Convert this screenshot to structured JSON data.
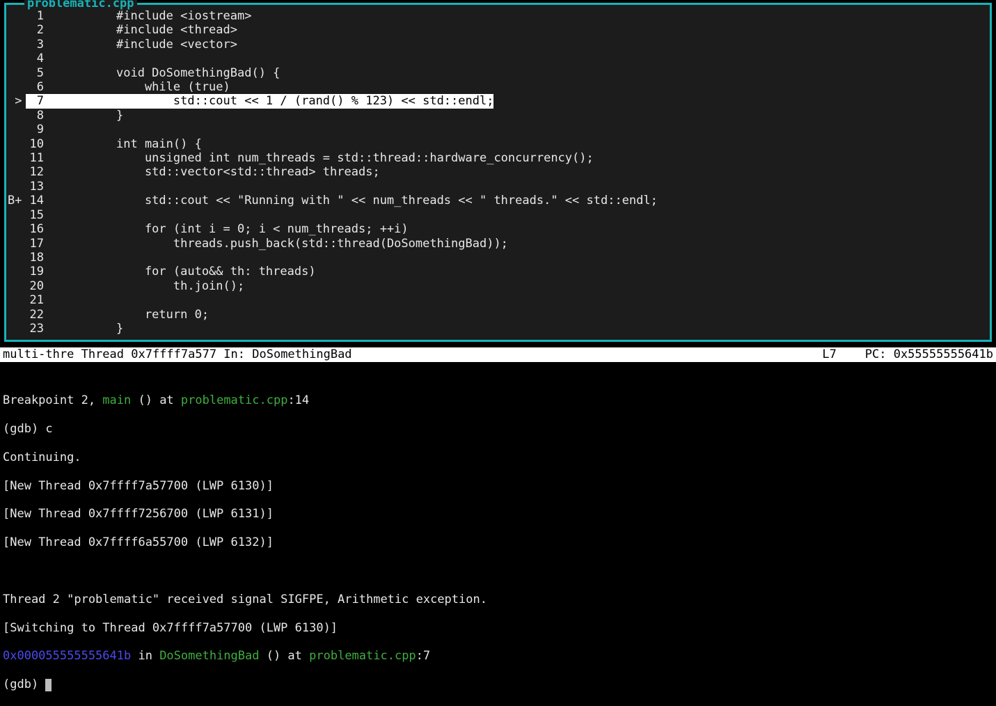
{
  "filename": "problematic.cpp",
  "source": {
    "lines": [
      {
        "n": 1,
        "marker": "",
        "text": "#include <iostream>"
      },
      {
        "n": 2,
        "marker": "",
        "text": "#include <thread>"
      },
      {
        "n": 3,
        "marker": "",
        "text": "#include <vector>"
      },
      {
        "n": 4,
        "marker": "",
        "text": ""
      },
      {
        "n": 5,
        "marker": "",
        "text": "void DoSomethingBad() {"
      },
      {
        "n": 6,
        "marker": "",
        "text": "    while (true)"
      },
      {
        "n": 7,
        "marker": " >",
        "text": "        std::cout << 1 / (rand() % 123) << std::endl;",
        "current": true
      },
      {
        "n": 8,
        "marker": "",
        "text": "}"
      },
      {
        "n": 9,
        "marker": "",
        "text": ""
      },
      {
        "n": 10,
        "marker": "",
        "text": "int main() {"
      },
      {
        "n": 11,
        "marker": "",
        "text": "    unsigned int num_threads = std::thread::hardware_concurrency();"
      },
      {
        "n": 12,
        "marker": "",
        "text": "    std::vector<std::thread> threads;"
      },
      {
        "n": 13,
        "marker": "",
        "text": ""
      },
      {
        "n": 14,
        "marker": "B+",
        "text": "    std::cout << \"Running with \" << num_threads << \" threads.\" << std::endl;"
      },
      {
        "n": 15,
        "marker": "",
        "text": ""
      },
      {
        "n": 16,
        "marker": "",
        "text": "    for (int i = 0; i < num_threads; ++i)"
      },
      {
        "n": 17,
        "marker": "",
        "text": "        threads.push_back(std::thread(DoSomethingBad));"
      },
      {
        "n": 18,
        "marker": "",
        "text": ""
      },
      {
        "n": 19,
        "marker": "",
        "text": "    for (auto&& th: threads)"
      },
      {
        "n": 20,
        "marker": "",
        "text": "        th.join();"
      },
      {
        "n": 21,
        "marker": "",
        "text": ""
      },
      {
        "n": 22,
        "marker": "",
        "text": "    return 0;"
      },
      {
        "n": 23,
        "marker": "",
        "text": "}"
      }
    ]
  },
  "status": {
    "left_mode": "multi-thre ",
    "left_thread": "Thread 0x7ffff7a577 ",
    "left_in": "In: ",
    "left_func": "DoSomethingBad",
    "right_line": "L7",
    "right_pc": "PC: 0x55555555641b"
  },
  "console": {
    "bp_prefix": "Breakpoint 2, ",
    "bp_func": "main",
    "bp_mid": " () at ",
    "bp_file": "problematic.cpp",
    "bp_line": ":14",
    "cmd_c": "(gdb) c",
    "continuing": "Continuing.",
    "new_thread_1": "[New Thread 0x7ffff7a57700 (LWP 6130)]",
    "new_thread_2": "[New Thread 0x7ffff7256700 (LWP 6131)]",
    "new_thread_3": "[New Thread 0x7ffff6a55700 (LWP 6132)]",
    "signal": "Thread 2 \"problematic\" received signal SIGFPE, Arithmetic exception.",
    "switching": "[Switching to Thread 0x7ffff7a57700 (LWP 6130)]",
    "addr": "0x000055555555641b",
    "in": " in ",
    "func": "DoSomethingBad",
    "paren": " () at ",
    "file": "problematic.cpp",
    "lineno": ":7",
    "prompt": "(gdb) "
  }
}
